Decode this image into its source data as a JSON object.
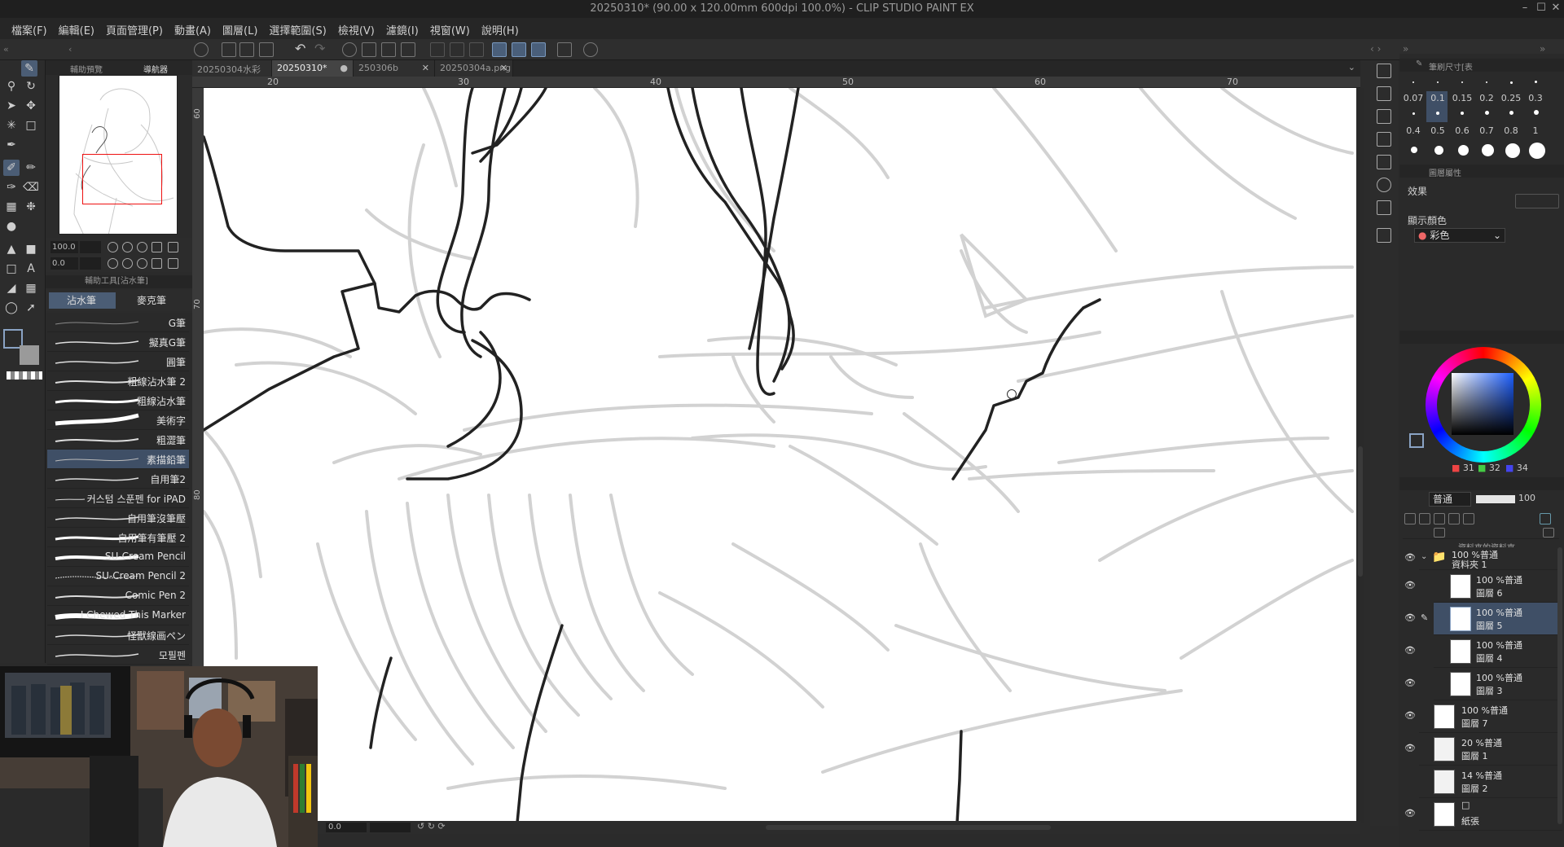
{
  "window": {
    "title": "20250310* (90.00 x 120.00mm 600dpi 100.0%) - CLIP STUDIO PAINT EX"
  },
  "menu": [
    "檔案(F)",
    "編輯(E)",
    "頁面管理(P)",
    "動畫(A)",
    "圖層(L)",
    "選擇範圍(S)",
    "檢視(V)",
    "濾鏡(I)",
    "視窗(W)",
    "說明(H)"
  ],
  "navigator": {
    "tab1": "輔助預覽",
    "tab2": "導航器",
    "zoom": "100.0",
    "rotation": "0.0"
  },
  "subtool": {
    "header": "輔助工具[沾水筆]",
    "tabs": [
      "沾水筆",
      "麥克筆"
    ],
    "brushes": [
      "G筆",
      "擬真G筆",
      "圓筆",
      "粗線沾水筆 2",
      "粗線沾水筆",
      "美術字",
      "粗澀筆",
      "素描鉛筆",
      "自用筆2",
      "커스텀 스푼펜 for iPAD",
      "自用筆沒筆壓",
      "自用筆有筆壓 2",
      "SU-Cream Pencil",
      "SU-Cream Pencil 2",
      "Comic Pen 2",
      "I Chewed This Marker",
      "怪獸線画ペン",
      "모필펜"
    ],
    "selected_index": 7
  },
  "doc_tabs": [
    {
      "label": "20250304水彩",
      "active": false
    },
    {
      "label": "20250310*",
      "active": true
    },
    {
      "label": "250306b",
      "active": false
    },
    {
      "label": "20250304a.png",
      "active": false
    }
  ],
  "ruler_h": [
    "20",
    "30",
    "40",
    "50",
    "60",
    "70"
  ],
  "ruler_v": [
    "60",
    "70",
    "80"
  ],
  "canvas_bottom": {
    "rotation_value": "0.0"
  },
  "brush_size": {
    "header": "筆刷尺寸[表",
    "sizes": [
      "0.07",
      "0.1",
      "0.15",
      "0.2",
      "0.25",
      "0.3",
      "0.4",
      "0.5",
      "0.6",
      "0.7",
      "0.8",
      "1"
    ],
    "selected": "0.5"
  },
  "layer_property": {
    "header": "圖層屬性",
    "effect_label": "效果",
    "display_color_label": "顯示顏色",
    "display_color_value": "彩色"
  },
  "color": {
    "r": "31",
    "g": "32",
    "b": "34",
    "main": "#1f2022",
    "sub": "#9a9a9a"
  },
  "layers_panel": {
    "blend_mode": "普通",
    "opacity": "100",
    "partial_top": "資料夾的資料夾",
    "folder": {
      "line1": "100 %普通",
      "name": "資料夾 1"
    },
    "layers": [
      {
        "mode": "100 %普通",
        "name": "圖層 6",
        "indent": true,
        "selected": false,
        "editing": false
      },
      {
        "mode": "100 %普通",
        "name": "圖層 5",
        "indent": true,
        "selected": true,
        "editing": true
      },
      {
        "mode": "100 %普通",
        "name": "圖層 4",
        "indent": true,
        "selected": false,
        "editing": false
      },
      {
        "mode": "100 %普通",
        "name": "圖層 3",
        "indent": true,
        "selected": false,
        "editing": false
      },
      {
        "mode": "100 %普通",
        "name": "圖層 7",
        "indent": false,
        "selected": false,
        "editing": false
      },
      {
        "mode": "20 %普通",
        "name": "圖層 1",
        "indent": false,
        "selected": false,
        "editing": false
      },
      {
        "mode": "14 %普通",
        "name": "圖層 2",
        "indent": false,
        "selected": false,
        "editing": false
      },
      {
        "mode": "",
        "name": "紙張",
        "indent": false,
        "selected": false,
        "editing": false
      }
    ]
  }
}
